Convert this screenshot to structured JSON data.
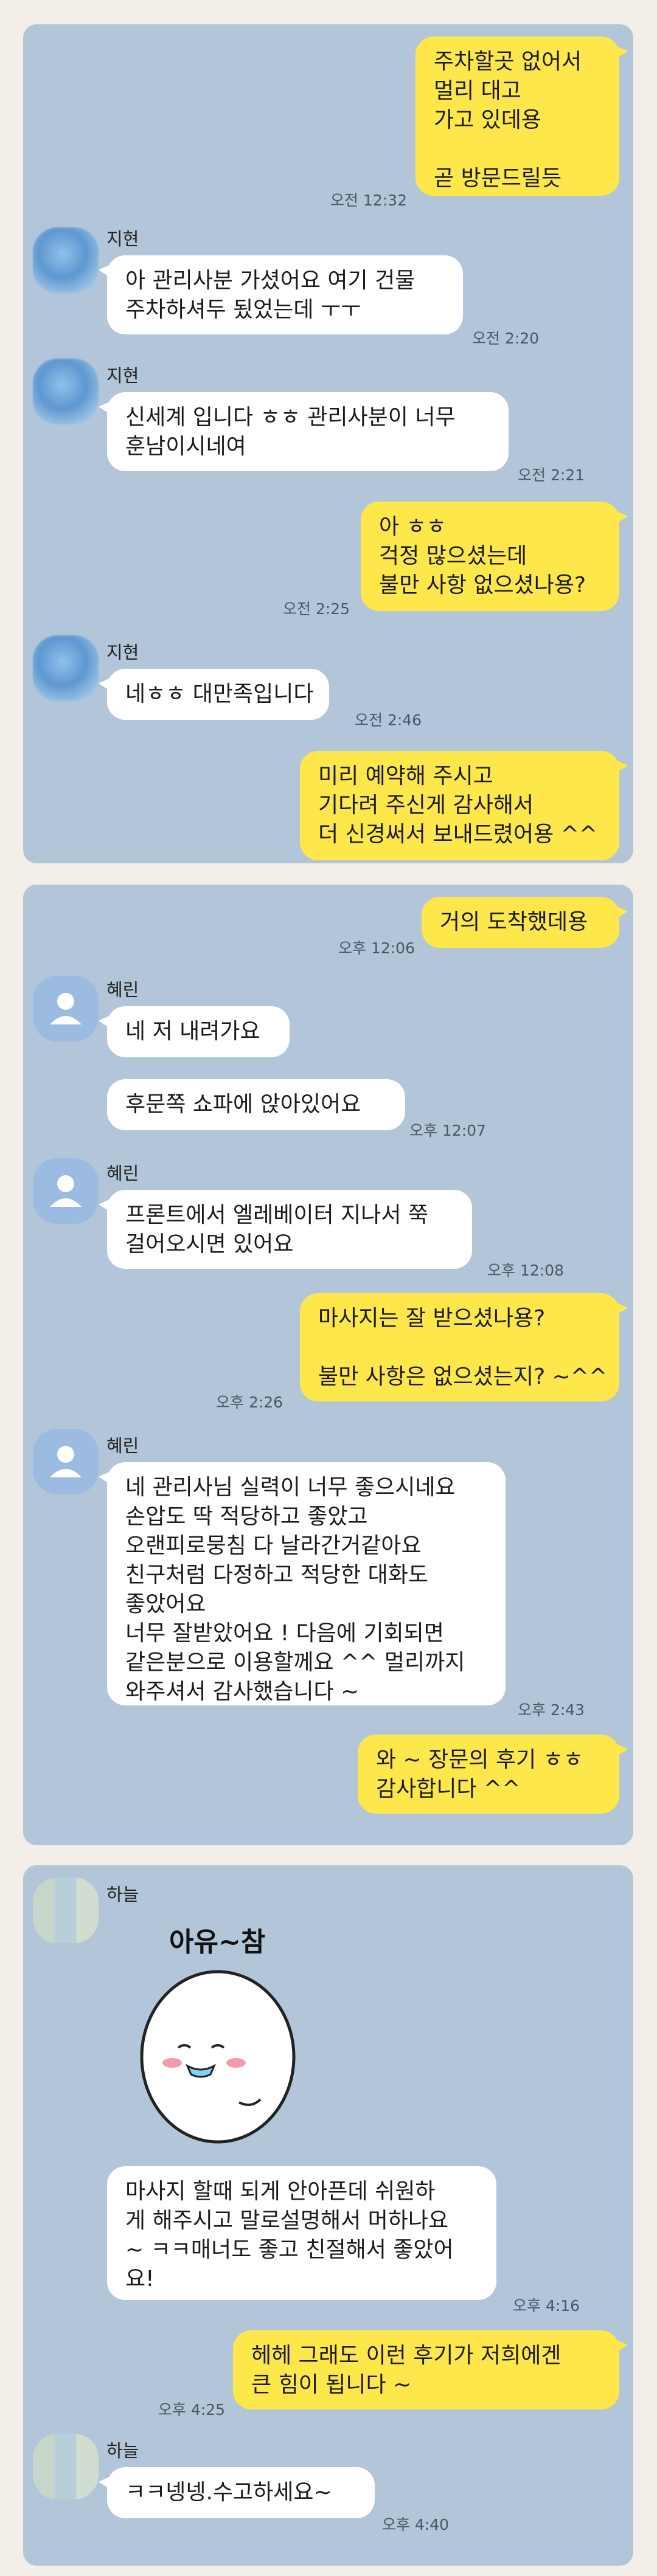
{
  "conversations": [
    {
      "messages": [
        {
          "type": "out",
          "text": "주차할곳 없어서\n멀리 대고\n가고 있데용\n\n곧 방문드릴듯",
          "time": "오전 12:32"
        },
        {
          "type": "in",
          "sender": "지현",
          "text": "아 관리사분 가셨어요 여기 건물\n주차하셔두 됬었는데 ㅜㅜ",
          "time": "오전 2:20"
        },
        {
          "type": "in",
          "sender": "지현",
          "text": "신세계 입니다 ㅎㅎ 관리사분이 너무\n훈남이시네여",
          "time": "오전 2:21"
        },
        {
          "type": "out",
          "text": "아 ㅎㅎ\n걱정 많으셨는데\n불만 사항 없으셨나용?",
          "time": "오전 2:25"
        },
        {
          "type": "in",
          "sender": "지현",
          "text": "네ㅎㅎ 대만족입니다",
          "time": "오전 2:46"
        },
        {
          "type": "out",
          "text": "미리 예약해 주시고\n기다려 주신게 감사해서\n더 신경써서 보내드렸어용 ^^",
          "time": ""
        }
      ]
    },
    {
      "messages": [
        {
          "type": "out",
          "text": "거의 도착했데용",
          "time": "오후 12:06"
        },
        {
          "type": "in",
          "sender": "혜린",
          "text": "네 저 내려가요",
          "time": ""
        },
        {
          "type": "in",
          "sender": "",
          "text": "후문쪽 쇼파에 앉아있어요",
          "time": "오후 12:07"
        },
        {
          "type": "in",
          "sender": "혜린",
          "text": "프론트에서 엘레베이터 지나서 쭉\n걸어오시면 있어요",
          "time": "오후 12:08"
        },
        {
          "type": "out",
          "text": "마사지는 잘 받으셨나용?\n\n불만 사항은 없으셨는지? ~^^",
          "time": "오후 2:26"
        },
        {
          "type": "in",
          "sender": "혜린",
          "text": "네 관리사님 실력이 너무 좋으시네요\n손압도 딱 적당하고 좋았고\n오랜피로뭉침 다 날라간거같아요\n친구처럼 다정하고 적당한 대화도\n좋았어요\n너무 잘받았어요 ! 다음에 기회되면\n같은분으로 이용할께요 ^^ 멀리까지\n와주셔서 감사했습니다 ~",
          "time": "오후 2:43"
        },
        {
          "type": "out",
          "text": "와 ~ 장문의 후기 ㅎㅎ\n감사합니다 ^^",
          "time": ""
        }
      ]
    },
    {
      "messages": [
        {
          "type": "sticker",
          "sender": "하늘",
          "sticker_text": "아유~참"
        },
        {
          "type": "in",
          "sender": "",
          "text": "마사지 할때 되게 안아픈데 쉬원하\n게 해주시고 말로설명해서 머하나요\n~ ㅋㅋ매너도 좋고 친절해서 좋았어\n요!",
          "time": "오후 4:16"
        },
        {
          "type": "out",
          "text": "헤헤 그래도 이런 후기가 저희에겐\n큰 힘이 됩니다 ~",
          "time": "오후 4:25"
        },
        {
          "type": "in",
          "sender": "하늘",
          "text": "ㅋㅋ넹넹.수고하세요~",
          "time": "오후 4:40"
        }
      ]
    }
  ],
  "colors": {
    "panel": "#b3c6d9",
    "outgoing": "#fde74b",
    "incoming": "#ffffff",
    "page": "#f3efe8"
  },
  "icons": {
    "default_avatar": "person-silhouette-icon",
    "blurred_avatar": "blurred-profile-photo",
    "pixel_avatar": "pixelated-profile-photo"
  }
}
